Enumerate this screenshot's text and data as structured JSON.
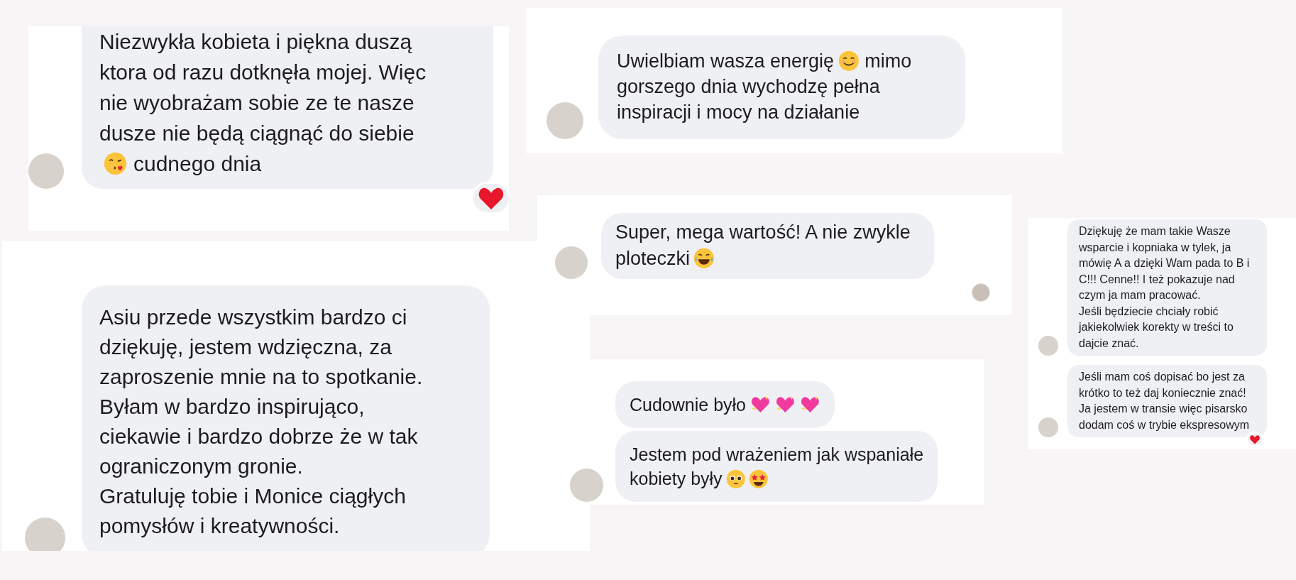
{
  "panels": [
    {
      "read_receipt": false,
      "messages": [
        {
          "avatar": true,
          "reaction": true,
          "parts": [
            {
              "kind": "paragraph",
              "text": "Niezwykła kobieta i piękna duszą\nktora od razu dotknęła mojej. Więc\nnie wyobrażam sobie ze te nasze\ndusze nie będą ciągnąć do siebie"
            },
            {
              "kind": "kiss-emoji"
            },
            {
              "kind": "text",
              "text": "cudnego dnia"
            }
          ]
        }
      ]
    },
    {
      "read_receipt": false,
      "messages": [
        {
          "avatar": true,
          "reaction": false,
          "parts": [
            {
              "kind": "paragraph",
              "text": "Asiu przede wszystkim bardzo ci\ndziękuję, jestem wdzięczna, za\nzaproszenie mnie na to spotkanie.\nByłam w bardzo inspirująco,\nciekawie i bardzo dobrze że w tak\nograniczonym gronie.\nGratuluję tobie i Monice ciągłych\npomysłów i kreatywności."
            }
          ]
        }
      ]
    },
    {
      "read_receipt": false,
      "messages": [
        {
          "avatar": true,
          "reaction": false,
          "parts": [
            {
              "kind": "text",
              "text": "Uwielbiam wasza energię"
            },
            {
              "kind": "smile-emoji"
            },
            {
              "kind": "text",
              "text": "mimo"
            },
            {
              "kind": "paragraph",
              "text": "gorszego dnia wychodzę pełna\ninspiracji i mocy na działanie"
            }
          ]
        }
      ]
    },
    {
      "read_receipt": true,
      "messages": [
        {
          "avatar": true,
          "reaction": false,
          "parts": [
            {
              "kind": "paragraph",
              "text": "Super, mega wartość! A nie zwykle"
            },
            {
              "kind": "text",
              "text": "ploteczki"
            },
            {
              "kind": "laugh-emoji"
            }
          ]
        }
      ]
    },
    {
      "read_receipt": false,
      "messages": [
        {
          "avatar": false,
          "reaction": false,
          "parts": [
            {
              "kind": "text",
              "text": "Cudownie było"
            },
            {
              "kind": "heart-emoji"
            },
            {
              "kind": "heart-emoji"
            },
            {
              "kind": "heart-emoji"
            }
          ]
        },
        {
          "avatar": true,
          "reaction": false,
          "parts": [
            {
              "kind": "paragraph",
              "text": "Jestem pod wrażeniem jak wspaniałe"
            },
            {
              "kind": "text",
              "text": "kobiety były"
            },
            {
              "kind": "teary-emoji"
            },
            {
              "kind": "star-emoji"
            }
          ]
        }
      ]
    },
    {
      "read_receipt": false,
      "messages": [
        {
          "avatar": true,
          "reaction": false,
          "parts": [
            {
              "kind": "paragraph",
              "text": "Dziękuję że mam takie Wasze\nwsparcie i kopniaka w tylek, ja\nmówię A a dzięki Wam pada to B i\nC!!! Cenne!! I też pokazuje nad\nczym ja mam pracować.\nJeśli będziecie chciały robić\njakiekolwiek korekty w treści to\ndajcie znać."
            }
          ]
        },
        {
          "avatar": true,
          "reaction": true,
          "parts": [
            {
              "kind": "paragraph",
              "text": "Jeśli mam coś dopisać bo jest za\nkrótko to też daj koniecznie znać!\nJa jestem w transie więc pisarsko\ndodam coś w trybie ekspresowym"
            }
          ]
        }
      ]
    }
  ]
}
